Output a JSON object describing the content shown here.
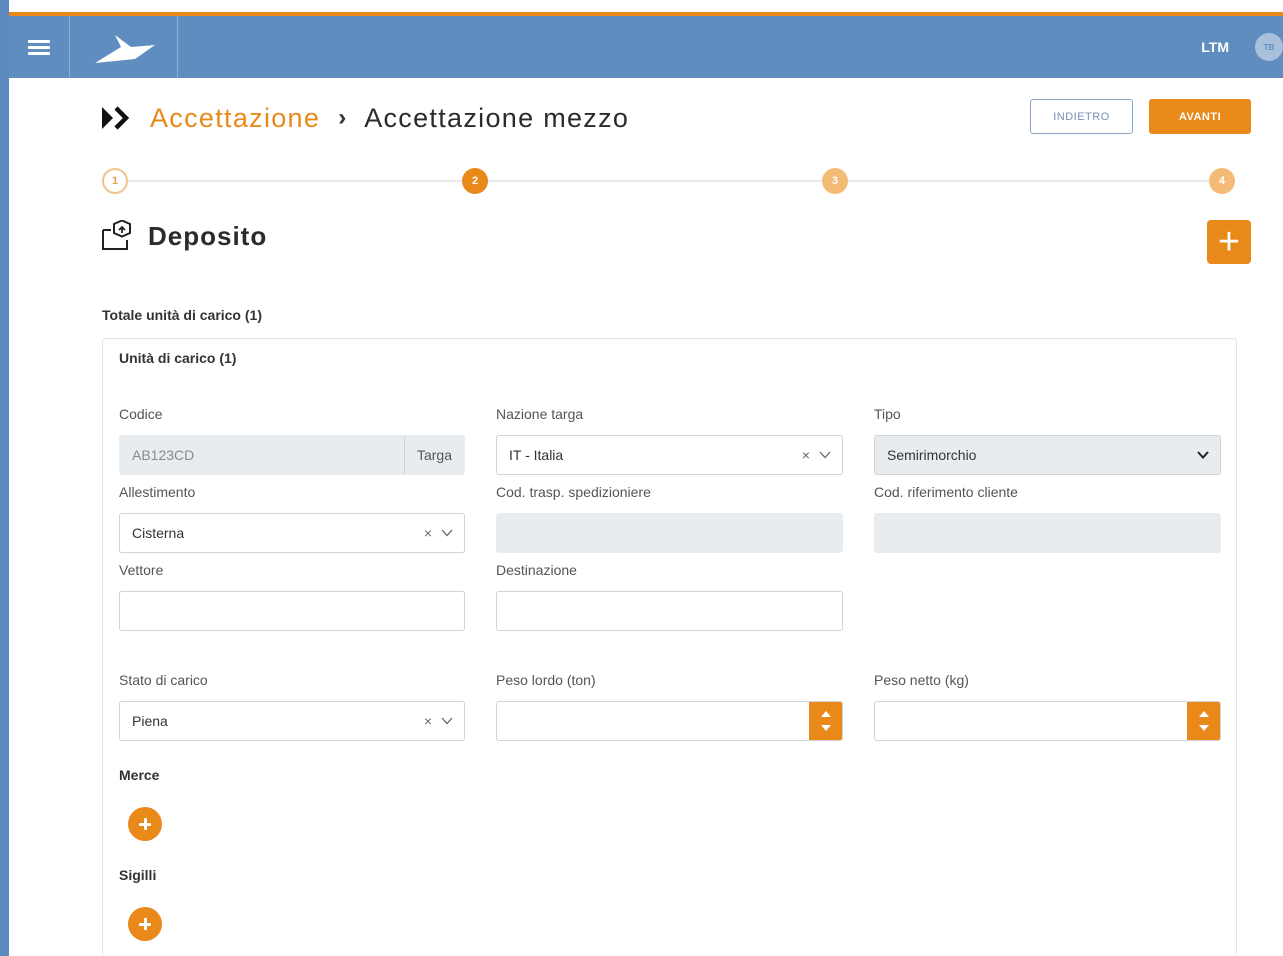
{
  "header": {
    "user_abbr": "LTM",
    "avatar_initials": "TB"
  },
  "breadcrumb": {
    "parent": "Accettazione",
    "separator": "›",
    "current": "Accettazione mezzo"
  },
  "actions": {
    "back_label": "INDIETRO",
    "next_label": "AVANTI"
  },
  "stepper": {
    "steps": [
      "1",
      "2",
      "3",
      "4"
    ],
    "active": 2
  },
  "section": {
    "title": "Deposito",
    "add_label": "+"
  },
  "totals": {
    "label": "Totale unità di carico (1)"
  },
  "card": {
    "title": "Unità di carico (1)",
    "fields": {
      "codice": {
        "label": "Codice",
        "value": "AB123CD",
        "addon": "Targa"
      },
      "nazione": {
        "label": "Nazione targa",
        "value": "IT - Italia"
      },
      "tipo": {
        "label": "Tipo",
        "value": "Semirimorchio"
      },
      "allestimento": {
        "label": "Allestimento",
        "value": "Cisterna"
      },
      "cod_trasp": {
        "label": "Cod. trasp. spedizioniere",
        "value": ""
      },
      "cod_rif": {
        "label": "Cod. riferimento cliente",
        "value": ""
      },
      "vettore": {
        "label": "Vettore",
        "value": ""
      },
      "destinazione": {
        "label": "Destinazione",
        "value": ""
      },
      "stato": {
        "label": "Stato di carico",
        "value": "Piena"
      },
      "peso_lordo": {
        "label": "Peso lordo (ton)",
        "value": ""
      },
      "peso_netto": {
        "label": "Peso netto (kg)",
        "value": ""
      }
    },
    "merce_label": "Merce",
    "sigilli_label": "Sigilli",
    "clear_glyph": "×"
  },
  "colors": {
    "accent": "#e8891a",
    "header": "#5f8dc0"
  },
  "icons": [
    "menu-icon",
    "logo-icon",
    "breadcrumb-chevrons-icon",
    "deposit-icon",
    "chevron-down-icon",
    "clear-icon",
    "spin-up-icon",
    "spin-down-icon",
    "plus-icon"
  ]
}
